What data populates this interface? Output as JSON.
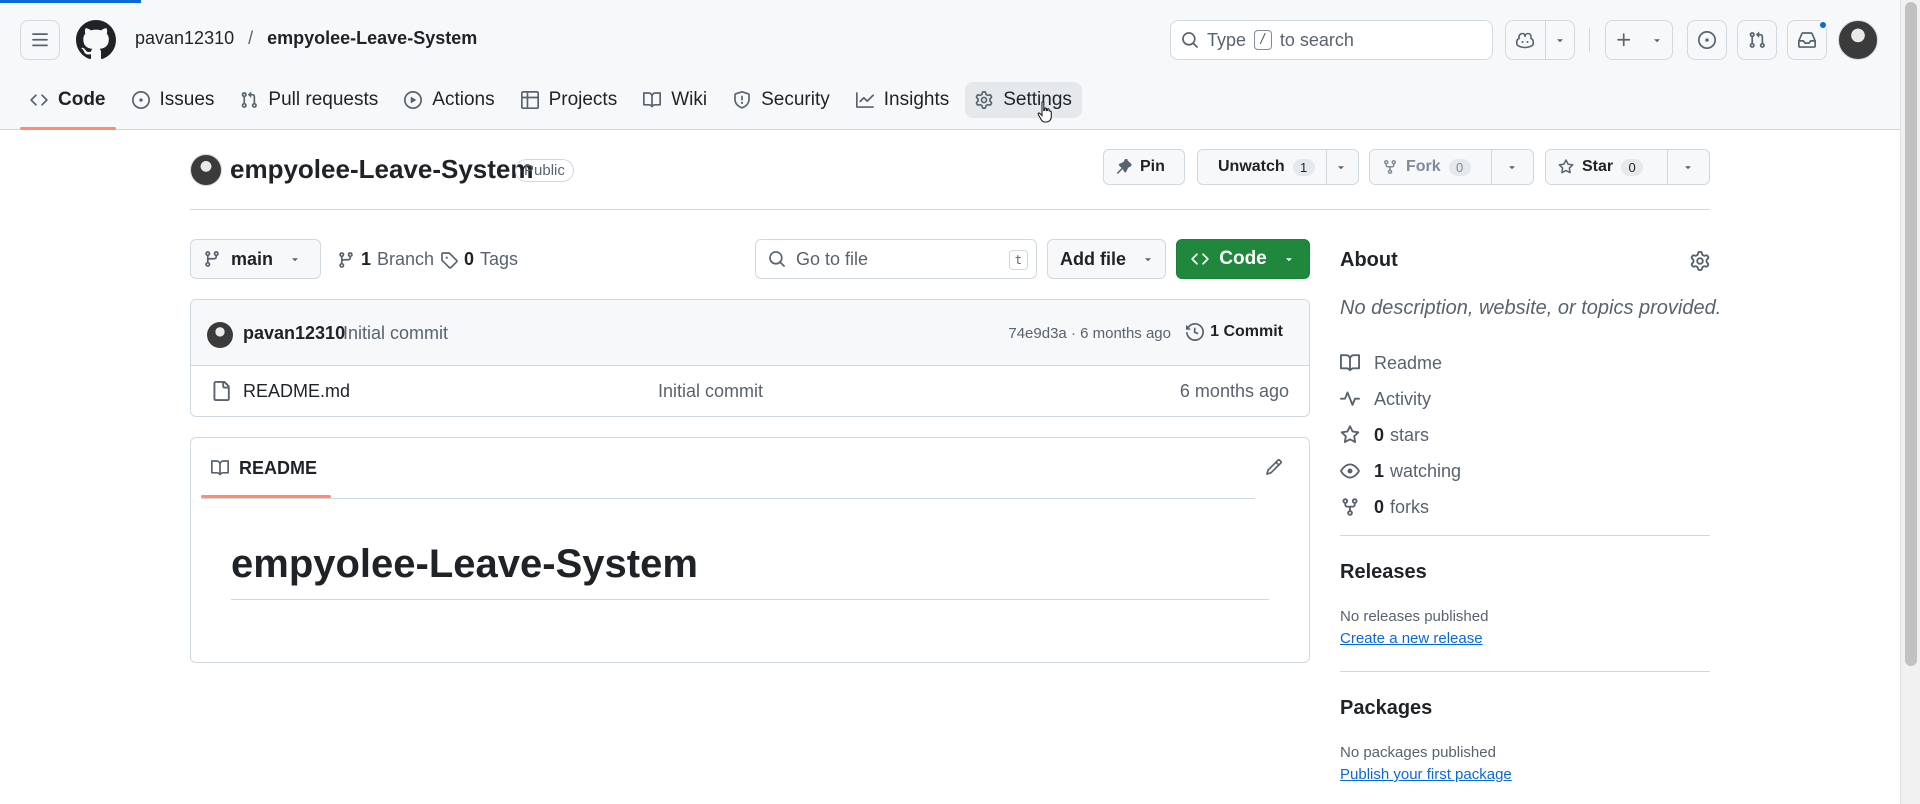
{
  "header": {
    "owner": "pavan12310",
    "separator": "/",
    "repo": "empyolee-Leave-System",
    "search": {
      "prefix": "Type",
      "key": "/",
      "suffix": "to search"
    }
  },
  "tabs": [
    {
      "label": "Code",
      "icon": "code-icon"
    },
    {
      "label": "Issues",
      "icon": "issue-opened-icon"
    },
    {
      "label": "Pull requests",
      "icon": "git-pull-request-icon"
    },
    {
      "label": "Actions",
      "icon": "play-icon"
    },
    {
      "label": "Projects",
      "icon": "table-icon"
    },
    {
      "label": "Wiki",
      "icon": "book-icon"
    },
    {
      "label": "Security",
      "icon": "shield-icon"
    },
    {
      "label": "Insights",
      "icon": "graph-icon"
    },
    {
      "label": "Settings",
      "icon": "gear-icon"
    }
  ],
  "repo_head": {
    "name": "empyolee-Leave-System",
    "visibility": "Public",
    "pin_label": "Pin",
    "watch_label": "Unwatch",
    "watch_count": "1",
    "fork_label": "Fork",
    "fork_count": "0",
    "star_label": "Star",
    "star_count": "0"
  },
  "file_nav": {
    "branch": "main",
    "branches_count": "1",
    "branches_label": "Branch",
    "tags_count": "0",
    "tags_label": "Tags",
    "goto_placeholder": "Go to file",
    "goto_key": "t",
    "add_file_label": "Add file",
    "code_label": "Code"
  },
  "commit": {
    "author": "pavan12310",
    "message": "Initial commit",
    "sha_time": "74e9d3a · 6 months ago",
    "count_label": "1 Commit"
  },
  "files": [
    {
      "name": "README.md",
      "message": "Initial commit",
      "age": "6 months ago"
    }
  ],
  "readme": {
    "tab_label": "README",
    "title": "empyolee-Leave-System"
  },
  "about": {
    "title": "About",
    "description": "No description, website, or topics provided.",
    "items": {
      "readme": "Readme",
      "activity": "Activity",
      "stars_count": "0",
      "stars_label": "stars",
      "watching_count": "1",
      "watching_label": "watching",
      "forks_count": "0",
      "forks_label": "forks"
    }
  },
  "releases": {
    "title": "Releases",
    "note": "No releases published",
    "link": "Create a new release"
  },
  "packages": {
    "title": "Packages",
    "note": "No packages published",
    "link": "Publish your first package"
  },
  "colors": {
    "accent": "#0969da",
    "tab_underline": "#fd8c73",
    "primary_button": "#1f883d"
  }
}
